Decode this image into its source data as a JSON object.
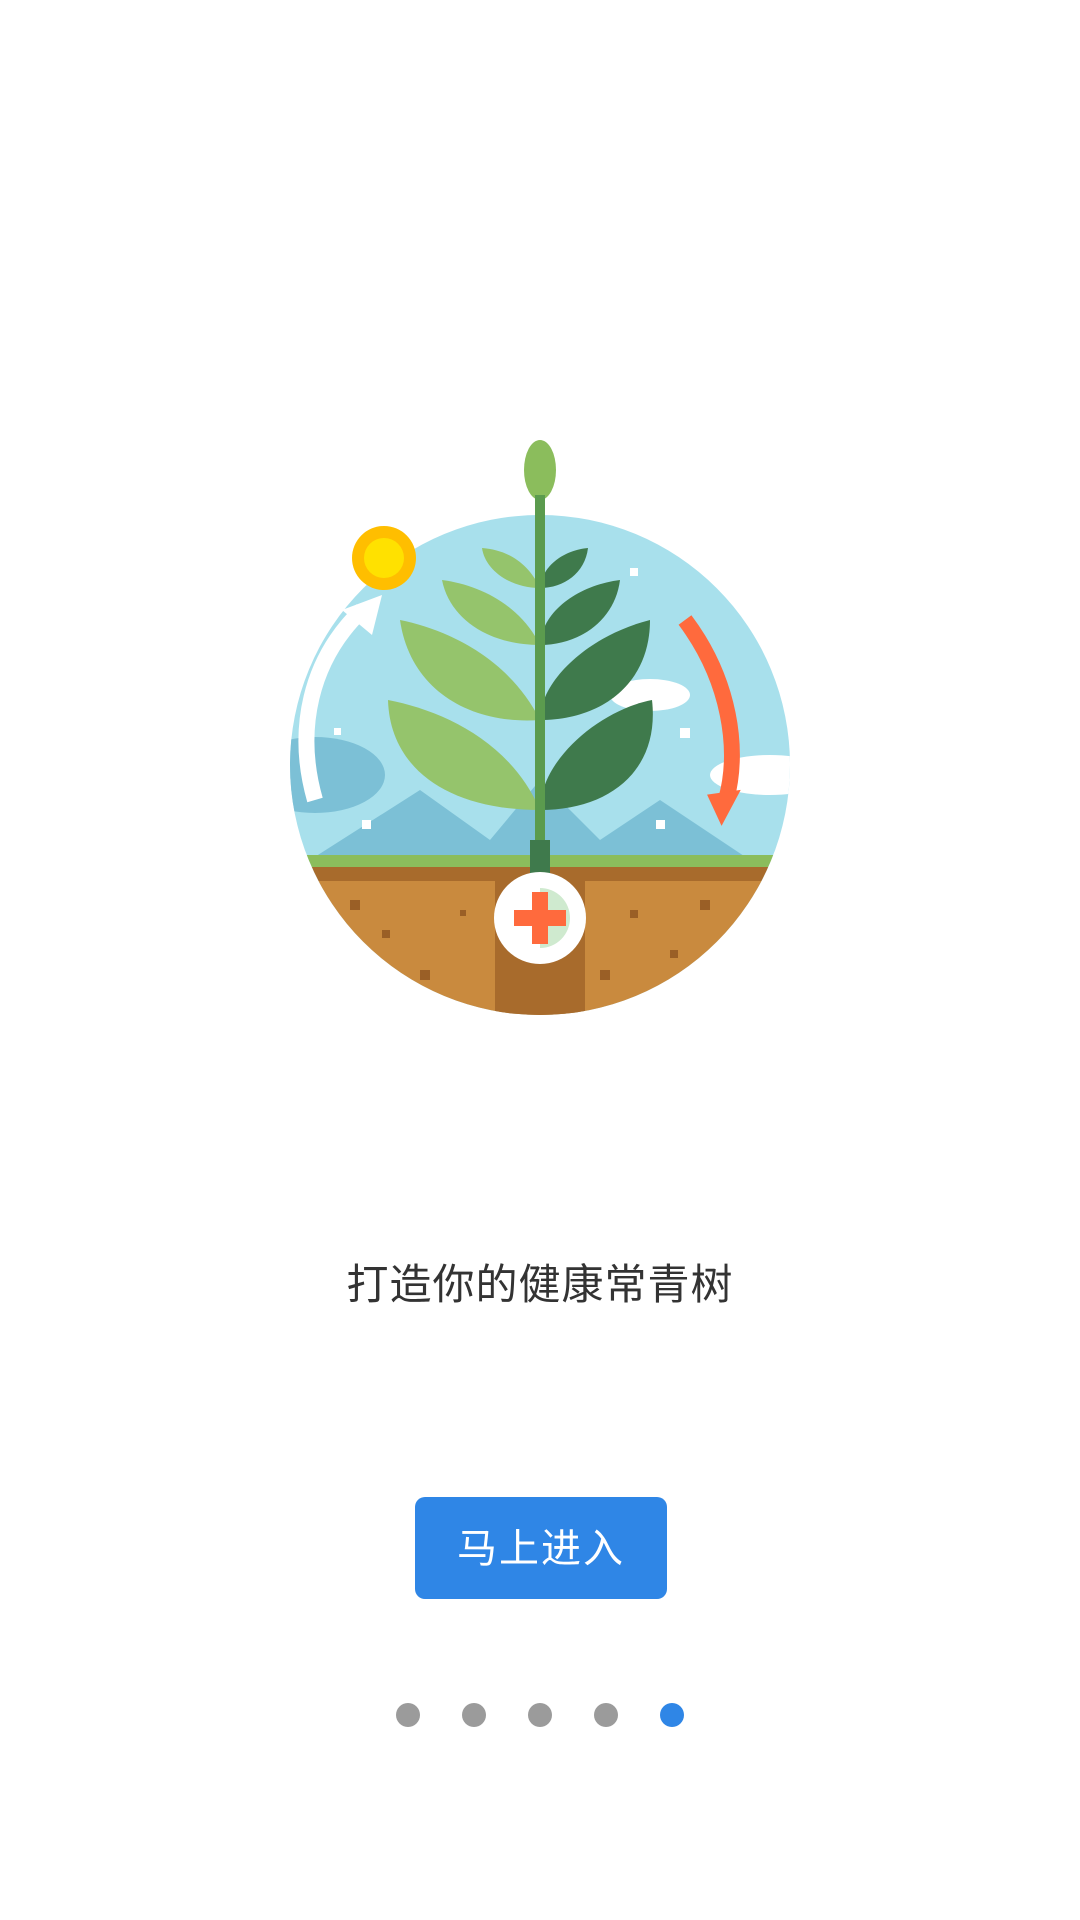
{
  "page": {
    "tagline": "打造你的健康常青树",
    "enter_button_label": "马上进入"
  },
  "pager": {
    "total": 5,
    "active_index": 4
  },
  "illustration": {
    "icon": "health-plant-illustration",
    "colors": {
      "sky": "#a8e0ec",
      "sun": "#ffd400",
      "soil": "#c98a3e",
      "grass": "#8bbd5c",
      "leaf_light": "#95c46c",
      "leaf_dark": "#3f7a4c",
      "arrow_orange": "#ff6a3d",
      "cross_red": "#ff6a3d"
    }
  },
  "colors": {
    "accent": "#2f86e6",
    "dot_inactive": "#9b9b9b",
    "text": "#333333"
  }
}
